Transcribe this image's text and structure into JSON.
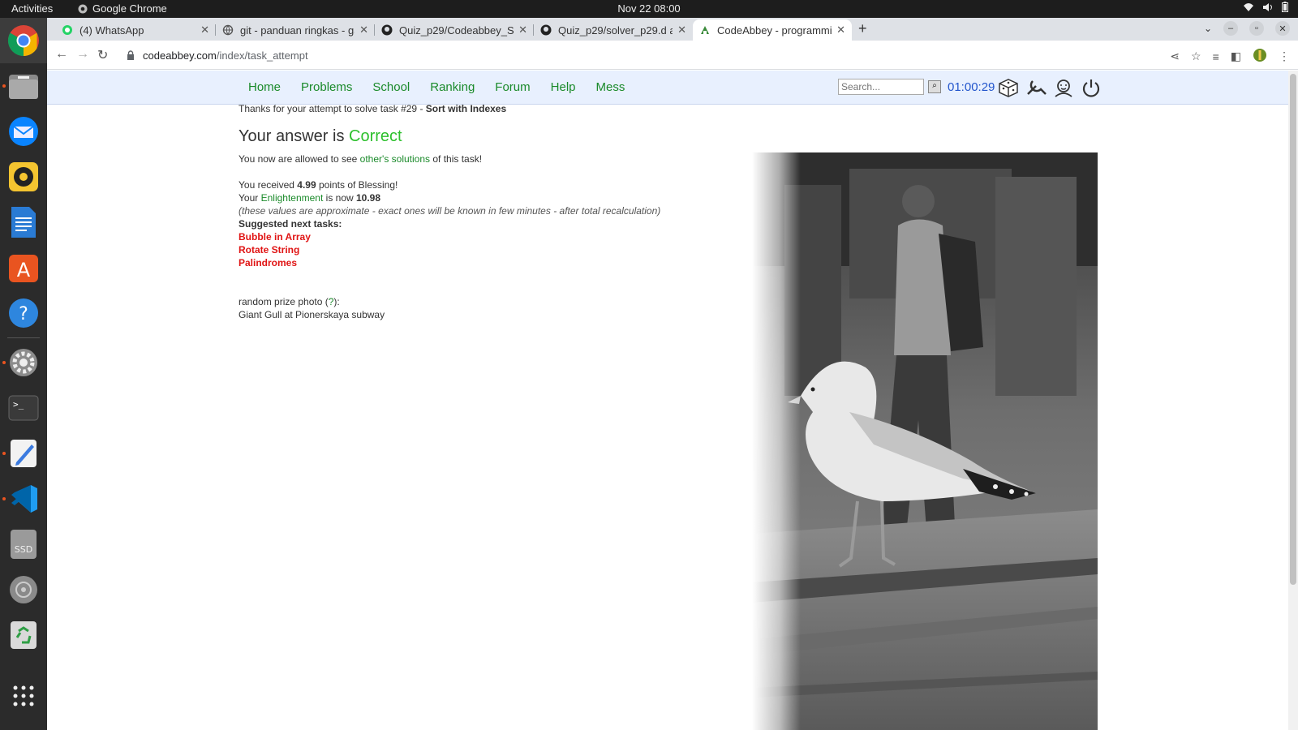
{
  "system": {
    "activities": "Activities",
    "app_name": "Google Chrome",
    "clock": "Nov 22  08:00"
  },
  "dock": [
    "chrome",
    "files",
    "thunderbird",
    "rhythmbox",
    "libreoffice-writer",
    "app-center",
    "help",
    "settings",
    "terminal",
    "text-editor",
    "vscode",
    "ssd-drive",
    "disc",
    "trash",
    "show-apps"
  ],
  "browser": {
    "tabs": [
      {
        "title": "(4) WhatsApp",
        "active": false
      },
      {
        "title": "git - panduan ringkas - ga",
        "active": false
      },
      {
        "title": "Quiz_p29/Codeabbey_Sc",
        "active": false
      },
      {
        "title": "Quiz_p29/solver_p29.d at",
        "active": false
      },
      {
        "title": "CodeAbbey - programmin",
        "active": true
      }
    ],
    "url_domain": "codeabbey.com",
    "url_path": "/index/task_attempt"
  },
  "site": {
    "menu": [
      "Home",
      "Problems",
      "School",
      "Ranking",
      "Forum",
      "Help",
      "Mess"
    ],
    "search_placeholder": "Search...",
    "timer": "01:00:29"
  },
  "page": {
    "thanks_prefix": "Thanks for your attempt to solve task #29 - ",
    "task_name": "Sort with Indexes",
    "answer_prefix": "Your answer is ",
    "answer_status": "Correct",
    "allowed_prefix": "You now are allowed to see ",
    "allowed_link": "other's solutions",
    "allowed_suffix": " of this task!",
    "received_prefix": "You received ",
    "points": "4.99",
    "received_suffix": " points of Blessing!",
    "enlight_prefix": "Your ",
    "enlight_link": "Enlightenment",
    "enlight_mid": " is now ",
    "enlight_value": "10.98",
    "approx_note": "(these values are approximate - exact ones will be known in few minutes - after total recalculation)",
    "suggested_label": "Suggested next tasks:",
    "suggested": [
      "Bubble in Array",
      "Rotate String",
      "Palindromes"
    ],
    "prize_prefix": "random prize photo (",
    "prize_link": "?",
    "prize_suffix": "):",
    "photo_caption": "Giant Gull at Pionerskaya subway"
  }
}
